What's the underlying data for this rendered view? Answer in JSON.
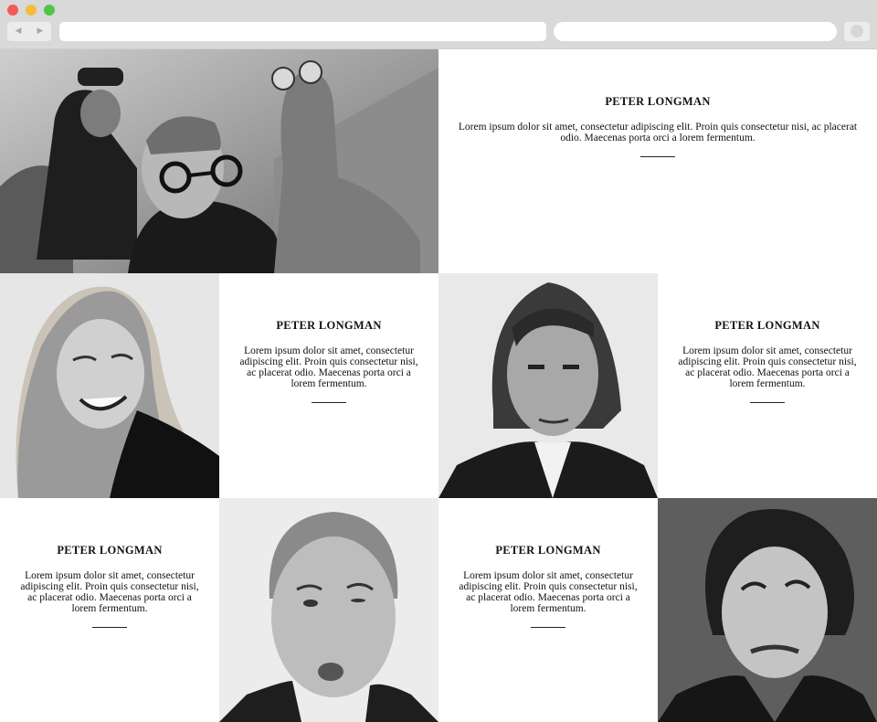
{
  "browser": {
    "back_icon": "back-arrow-icon",
    "forward_icon": "forward-arrow-icon",
    "back_glyph": "◀",
    "forward_glyph": "▶",
    "window_controls": {
      "close": "#f25a56",
      "minimize": "#f6bd3b",
      "zoom": "#4fc647"
    }
  },
  "team": [
    {
      "name": "PETER LONGMAN",
      "bio": "Lorem ipsum dolor sit amet, consectetur adipiscing elit. Proin quis consectetur nisi, ac placerat odio. Maecenas porta orci a lorem fermentum."
    },
    {
      "name": "PETER LONGMAN",
      "bio": "Lorem ipsum dolor sit amet, consectetur adipiscing elit. Proin quis consectetur nisi, ac placerat odio. Maecenas porta orci a lorem fermentum."
    },
    {
      "name": "PETER LONGMAN",
      "bio": "Lorem ipsum dolor sit amet, consectetur adipiscing elit. Proin quis consectetur nisi, ac placerat odio. Maecenas porta orci a lorem fermentum."
    },
    {
      "name": "PETER LONGMAN",
      "bio": "Lorem ipsum dolor sit amet, consectetur adipiscing elit. Proin quis consectetur nisi, ac placerat odio. Maecenas porta orci a lorem fermentum."
    },
    {
      "name": "PETER LONGMAN",
      "bio": "Lorem ipsum dolor sit amet, consectetur adipiscing elit. Proin quis consectetur nisi, ac placerat odio. Maecenas porta orci a lorem fermentum."
    }
  ]
}
